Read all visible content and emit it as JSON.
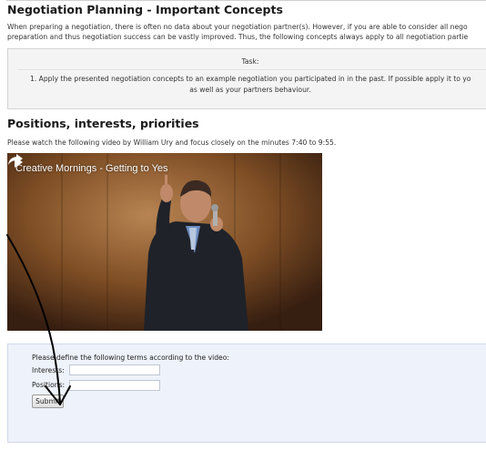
{
  "page": {
    "title": "Negotiation Planning - Important Concepts",
    "intro_lines": [
      "When preparing a negotiation, there is often no data about your negotiation partner(s). However, if you are able to consider all nego",
      "preparation and thus negotiation success can be vastly improved. Thus, the following concepts always apply to all negotiation partie"
    ]
  },
  "task": {
    "label": "Task:",
    "line1": "1. Apply the presented negotiation concepts to an example negotiation you participated in in the past. If possible apply it to yo",
    "line2": "as well as your partners behaviour."
  },
  "section": {
    "title": "Positions, interests, priorities",
    "text": "Please watch the following video by William Ury and focus closely on the minutes 7:40 to 9:55."
  },
  "video": {
    "title": "Creative Mornings - Getting to Yes",
    "icons": [
      "share-icon",
      "play-icon"
    ]
  },
  "form": {
    "instruction": "Please define the following terms according to the video:",
    "interests_label": "Interests:",
    "positions_label": "Positions:",
    "interests_value": "",
    "positions_value": "",
    "submit_label": "Submit"
  }
}
